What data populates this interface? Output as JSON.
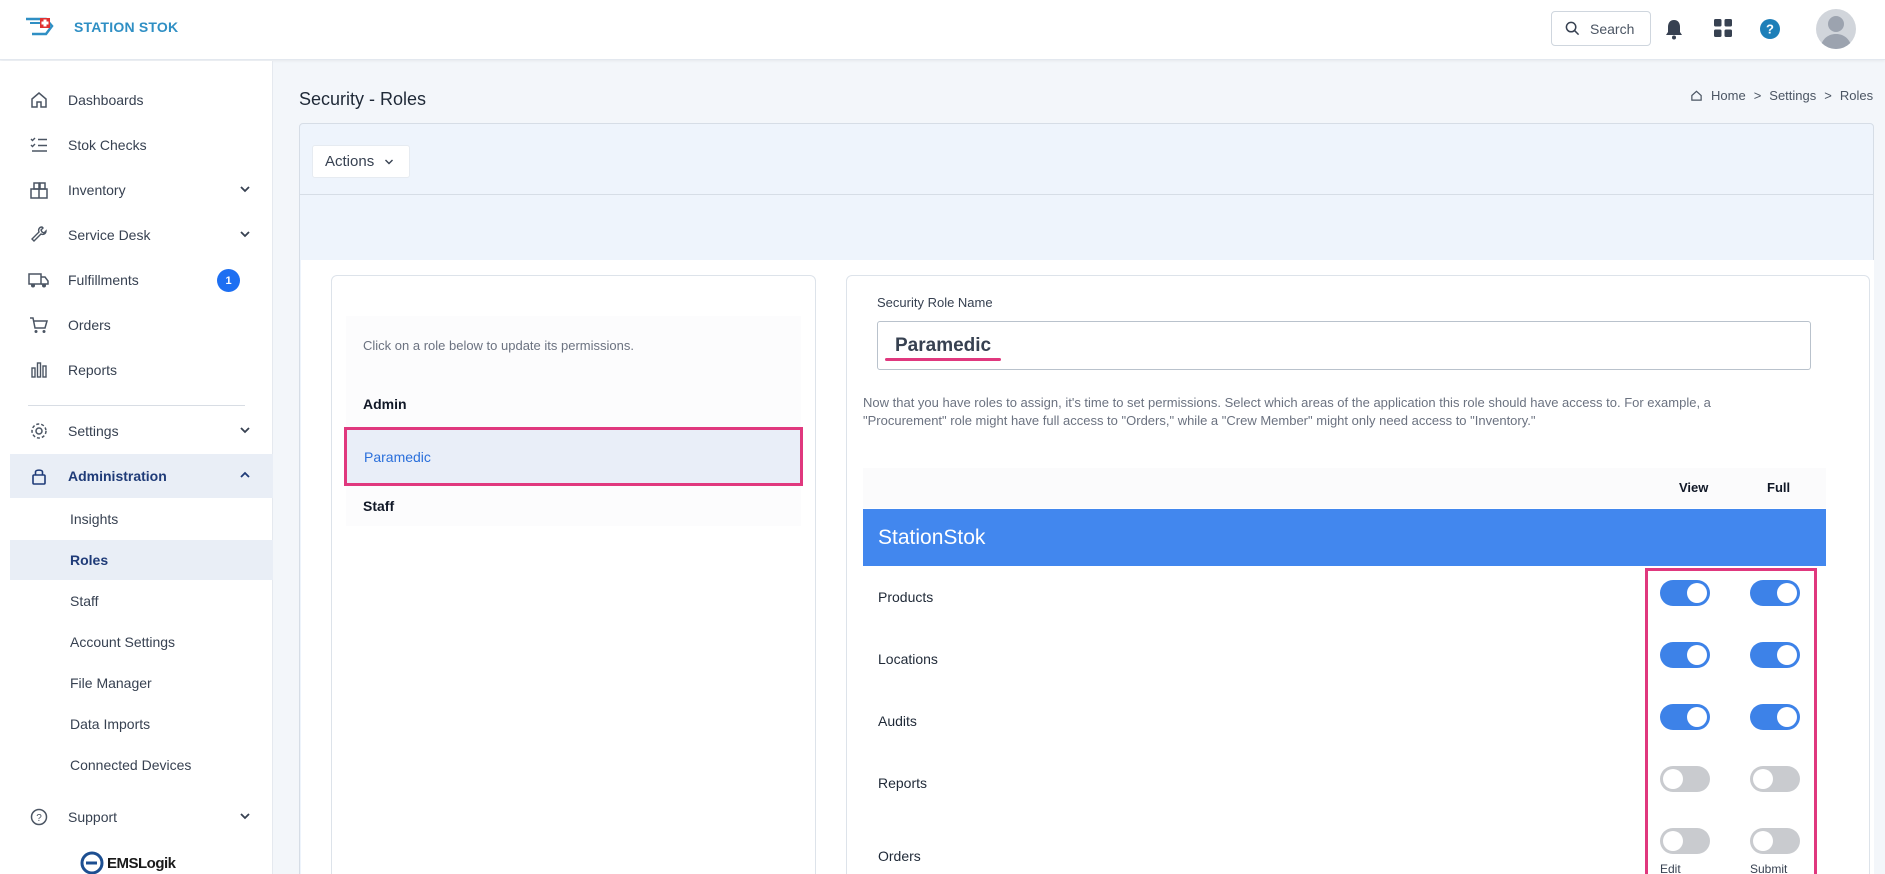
{
  "header": {
    "logo_text": "STATION STOK",
    "search_label": "Search"
  },
  "sidebar": {
    "items": [
      {
        "label": "Dashboards",
        "icon": "home-icon"
      },
      {
        "label": "Stok Checks",
        "icon": "checklist-icon"
      },
      {
        "label": "Inventory",
        "icon": "boxes-icon"
      },
      {
        "label": "Service Desk",
        "icon": "wrench-icon"
      },
      {
        "label": "Fulfillments",
        "icon": "truck-icon",
        "badge": "1"
      },
      {
        "label": "Orders",
        "icon": "cart-icon"
      },
      {
        "label": "Reports",
        "icon": "bar-chart-icon"
      },
      {
        "label": "Settings",
        "icon": "gear-icon"
      },
      {
        "label": "Administration",
        "icon": "lock-icon"
      },
      {
        "label": "Support",
        "icon": "help-circle-icon"
      }
    ],
    "admin_sub": [
      "Insights",
      "Roles",
      "Staff",
      "Account Settings",
      "File Manager",
      "Data Imports",
      "Connected Devices"
    ],
    "footer_brand": "EMSLogik"
  },
  "page": {
    "title": "Security - Roles",
    "breadcrumb": [
      "Home",
      "Settings",
      "Roles"
    ],
    "actions_label": "Actions"
  },
  "roles": {
    "hint": "Click on a role below to update its permissions.",
    "list": [
      "Admin",
      "Paramedic",
      "Staff"
    ],
    "selected": "Paramedic"
  },
  "permissions": {
    "role_name_label": "Security Role Name",
    "role_name_value": "Paramedic",
    "description": "Now that you have roles to assign, it's time to set permissions. Select which areas of the application this role should have access to. For example, a \"Procurement\" role might have full access to \"Orders,\" while a \"Crew Member\" might only need access to \"Inventory.\"",
    "col_view": "View",
    "col_full": "Full",
    "section": "StationStok",
    "rows": [
      {
        "name": "Products",
        "view": true,
        "full": true
      },
      {
        "name": "Locations",
        "view": true,
        "full": true
      },
      {
        "name": "Audits",
        "view": true,
        "full": true
      },
      {
        "name": "Reports",
        "view": false,
        "full": false
      },
      {
        "name": "Orders",
        "view": false,
        "full": false
      }
    ],
    "orders_sub_edit": "Edit",
    "orders_sub_submit": "Submit"
  },
  "colors": {
    "accent": "#3d82e8",
    "highlight": "#e0387e",
    "section_bar": "#4287ee"
  }
}
